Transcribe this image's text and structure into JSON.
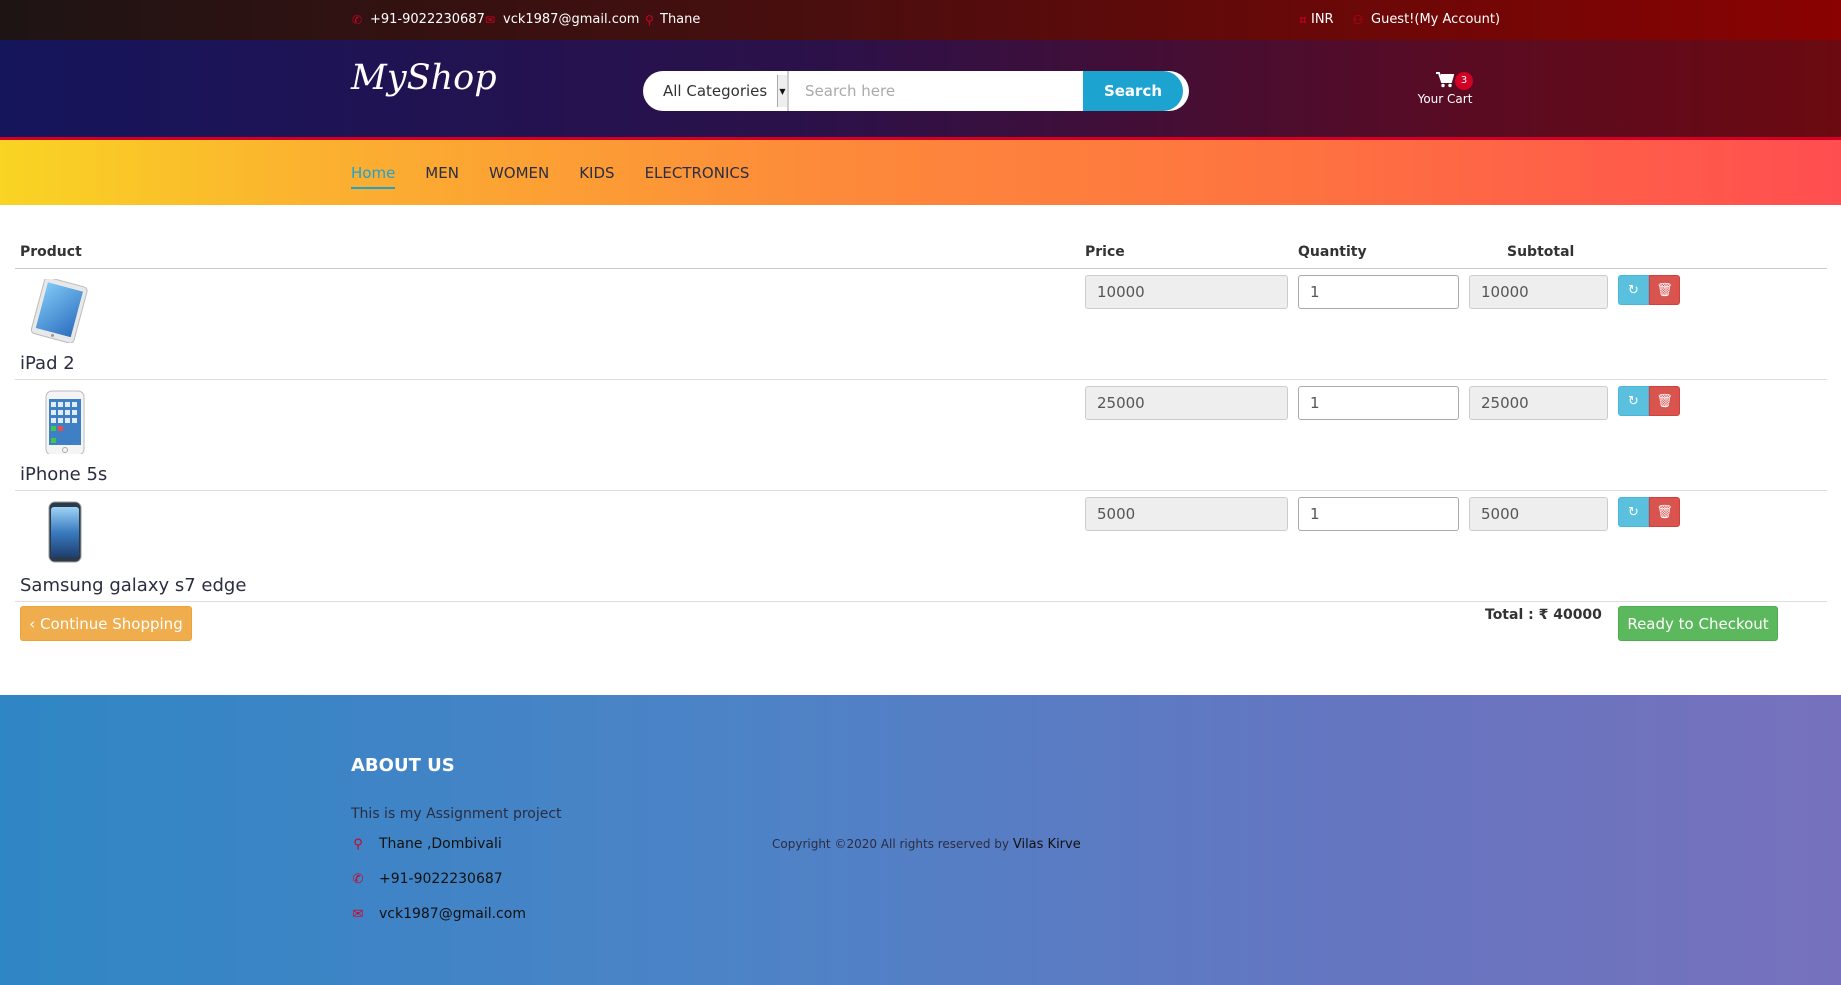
{
  "topbar": {
    "phone": "+91-9022230687",
    "email": "vck1987@gmail.com",
    "location": "Thane",
    "currency": "INR",
    "account": "Guest!(My Account)"
  },
  "header": {
    "logo": "MyShop",
    "category_selected": "All Categories",
    "search_placeholder": "Search here",
    "search_button": "Search",
    "cart_label": "Your Cart",
    "cart_count": "3"
  },
  "nav": {
    "items": [
      "Home",
      "MEN",
      "WOMEN",
      "KIDS",
      "ELECTRONICS"
    ],
    "active": "Home"
  },
  "cart": {
    "columns": {
      "product": "Product",
      "price": "Price",
      "quantity": "Quantity",
      "subtotal": "Subtotal"
    },
    "rows": [
      {
        "name": "iPad 2",
        "price": "10000",
        "quantity": "1",
        "subtotal": "10000"
      },
      {
        "name": "iPhone 5s",
        "price": "25000",
        "quantity": "1",
        "subtotal": "25000"
      },
      {
        "name": "Samsung galaxy s7 edge",
        "price": "5000",
        "quantity": "1",
        "subtotal": "5000"
      }
    ],
    "continue_label": "‹ Continue Shopping",
    "total_label": "Total : ₹ 40000",
    "checkout_label": "Ready to Checkout"
  },
  "footer": {
    "about_title": "ABOUT US",
    "about_text": "This is my Assignment project",
    "address": "Thane ,Dombivali",
    "phone": "+91-9022230687",
    "email": "vck1987@gmail.com",
    "copyright": "Copyright ©2020 All rights reserved by",
    "author": "Vilas Kirve"
  },
  "colors": {
    "accent_red": "#d10024",
    "accent_blue": "#1ca3d0",
    "warning": "#f0ad4e",
    "success": "#5cb85c",
    "danger": "#d9534f",
    "info": "#5bc0de"
  },
  "icons": {
    "phone": "phone-icon",
    "email": "envelope-icon",
    "location": "map-marker-icon",
    "currency": "currency-icon",
    "account": "user-icon",
    "cart": "shopping-cart-icon",
    "refresh": "refresh-icon",
    "delete": "trash-icon"
  }
}
